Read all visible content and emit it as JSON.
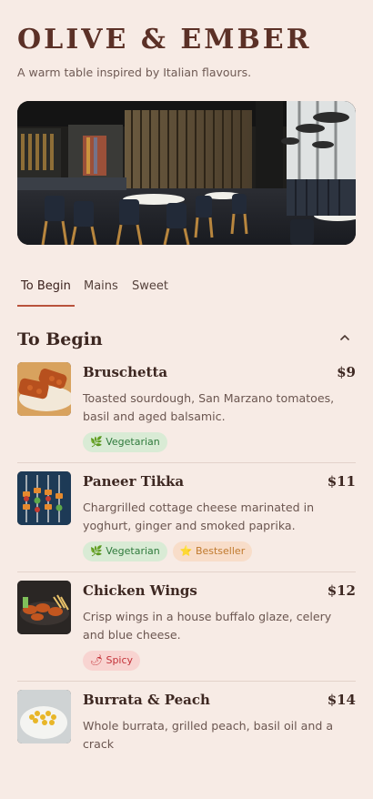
{
  "brand": {
    "title": "OLIVE & EMBER",
    "tagline": "A warm table inspired by Italian flavours."
  },
  "tabs": [
    {
      "label": "To Begin",
      "active": true
    },
    {
      "label": "Mains",
      "active": false
    },
    {
      "label": "Sweet",
      "active": false
    }
  ],
  "section": {
    "title": "To Begin",
    "collapse_icon": "chevron-up-icon"
  },
  "items": [
    {
      "name": "Bruschetta",
      "price": "$9",
      "desc": "Toasted sourdough, San Marzano tomatoes, basil and aged balsamic.",
      "badges": [
        {
          "icon": "🌿",
          "label": "Vegetarian"
        }
      ]
    },
    {
      "name": "Paneer Tikka",
      "price": "$11",
      "desc": "Chargrilled cottage cheese marinated in yoghurt, ginger and smoked paprika.",
      "badges": [
        {
          "icon": "🌿",
          "label": "Vegetarian"
        },
        {
          "icon": "⭐",
          "label": "Bestseller"
        }
      ]
    },
    {
      "name": "Chicken Wings",
      "price": "$12",
      "desc": "Crisp wings in a house buffalo glaze, celery and blue cheese.",
      "badges": [
        {
          "icon": "🌶",
          "label": "Spicy"
        }
      ]
    },
    {
      "name": "Burrata & Peach",
      "price": "$14",
      "desc": "Whole burrata, grilled peach, basil oil and a crack"
    }
  ],
  "colors": {
    "background": "#f7ebe5",
    "accent": "#b9523c",
    "title": "#5b3026",
    "text": "#3d2721",
    "vegetarian": "#2f7a3c",
    "bestseller": "#c07a2e",
    "spicy": "#c4333a"
  }
}
